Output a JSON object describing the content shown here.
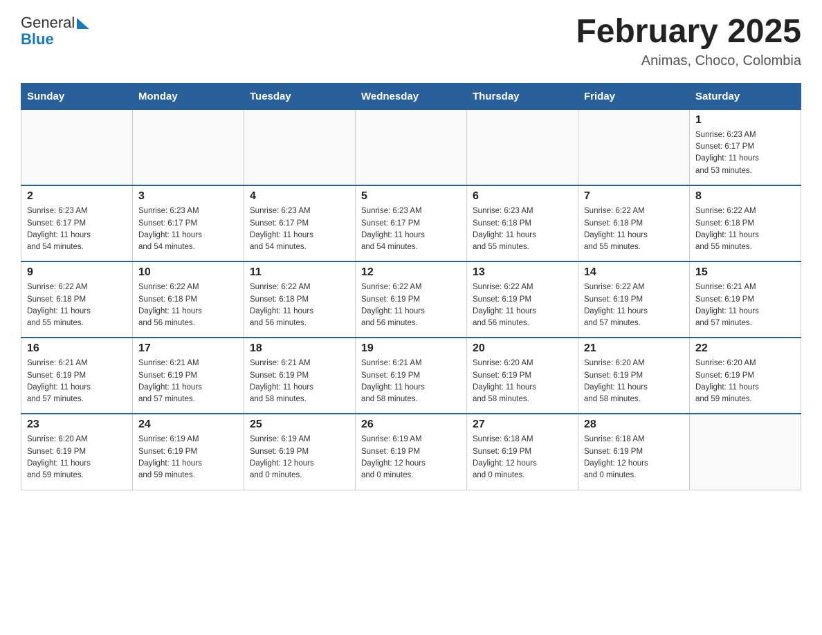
{
  "header": {
    "logo_general": "General",
    "logo_blue": "Blue",
    "title": "February 2025",
    "subtitle": "Animas, Choco, Colombia"
  },
  "calendar": {
    "days_of_week": [
      "Sunday",
      "Monday",
      "Tuesday",
      "Wednesday",
      "Thursday",
      "Friday",
      "Saturday"
    ],
    "weeks": [
      {
        "days": [
          {
            "num": "",
            "info": ""
          },
          {
            "num": "",
            "info": ""
          },
          {
            "num": "",
            "info": ""
          },
          {
            "num": "",
            "info": ""
          },
          {
            "num": "",
            "info": ""
          },
          {
            "num": "",
            "info": ""
          },
          {
            "num": "1",
            "info": "Sunrise: 6:23 AM\nSunset: 6:17 PM\nDaylight: 11 hours\nand 53 minutes."
          }
        ]
      },
      {
        "days": [
          {
            "num": "2",
            "info": "Sunrise: 6:23 AM\nSunset: 6:17 PM\nDaylight: 11 hours\nand 54 minutes."
          },
          {
            "num": "3",
            "info": "Sunrise: 6:23 AM\nSunset: 6:17 PM\nDaylight: 11 hours\nand 54 minutes."
          },
          {
            "num": "4",
            "info": "Sunrise: 6:23 AM\nSunset: 6:17 PM\nDaylight: 11 hours\nand 54 minutes."
          },
          {
            "num": "5",
            "info": "Sunrise: 6:23 AM\nSunset: 6:17 PM\nDaylight: 11 hours\nand 54 minutes."
          },
          {
            "num": "6",
            "info": "Sunrise: 6:23 AM\nSunset: 6:18 PM\nDaylight: 11 hours\nand 55 minutes."
          },
          {
            "num": "7",
            "info": "Sunrise: 6:22 AM\nSunset: 6:18 PM\nDaylight: 11 hours\nand 55 minutes."
          },
          {
            "num": "8",
            "info": "Sunrise: 6:22 AM\nSunset: 6:18 PM\nDaylight: 11 hours\nand 55 minutes."
          }
        ]
      },
      {
        "days": [
          {
            "num": "9",
            "info": "Sunrise: 6:22 AM\nSunset: 6:18 PM\nDaylight: 11 hours\nand 55 minutes."
          },
          {
            "num": "10",
            "info": "Sunrise: 6:22 AM\nSunset: 6:18 PM\nDaylight: 11 hours\nand 56 minutes."
          },
          {
            "num": "11",
            "info": "Sunrise: 6:22 AM\nSunset: 6:18 PM\nDaylight: 11 hours\nand 56 minutes."
          },
          {
            "num": "12",
            "info": "Sunrise: 6:22 AM\nSunset: 6:19 PM\nDaylight: 11 hours\nand 56 minutes."
          },
          {
            "num": "13",
            "info": "Sunrise: 6:22 AM\nSunset: 6:19 PM\nDaylight: 11 hours\nand 56 minutes."
          },
          {
            "num": "14",
            "info": "Sunrise: 6:22 AM\nSunset: 6:19 PM\nDaylight: 11 hours\nand 57 minutes."
          },
          {
            "num": "15",
            "info": "Sunrise: 6:21 AM\nSunset: 6:19 PM\nDaylight: 11 hours\nand 57 minutes."
          }
        ]
      },
      {
        "days": [
          {
            "num": "16",
            "info": "Sunrise: 6:21 AM\nSunset: 6:19 PM\nDaylight: 11 hours\nand 57 minutes."
          },
          {
            "num": "17",
            "info": "Sunrise: 6:21 AM\nSunset: 6:19 PM\nDaylight: 11 hours\nand 57 minutes."
          },
          {
            "num": "18",
            "info": "Sunrise: 6:21 AM\nSunset: 6:19 PM\nDaylight: 11 hours\nand 58 minutes."
          },
          {
            "num": "19",
            "info": "Sunrise: 6:21 AM\nSunset: 6:19 PM\nDaylight: 11 hours\nand 58 minutes."
          },
          {
            "num": "20",
            "info": "Sunrise: 6:20 AM\nSunset: 6:19 PM\nDaylight: 11 hours\nand 58 minutes."
          },
          {
            "num": "21",
            "info": "Sunrise: 6:20 AM\nSunset: 6:19 PM\nDaylight: 11 hours\nand 58 minutes."
          },
          {
            "num": "22",
            "info": "Sunrise: 6:20 AM\nSunset: 6:19 PM\nDaylight: 11 hours\nand 59 minutes."
          }
        ]
      },
      {
        "days": [
          {
            "num": "23",
            "info": "Sunrise: 6:20 AM\nSunset: 6:19 PM\nDaylight: 11 hours\nand 59 minutes."
          },
          {
            "num": "24",
            "info": "Sunrise: 6:19 AM\nSunset: 6:19 PM\nDaylight: 11 hours\nand 59 minutes."
          },
          {
            "num": "25",
            "info": "Sunrise: 6:19 AM\nSunset: 6:19 PM\nDaylight: 12 hours\nand 0 minutes."
          },
          {
            "num": "26",
            "info": "Sunrise: 6:19 AM\nSunset: 6:19 PM\nDaylight: 12 hours\nand 0 minutes."
          },
          {
            "num": "27",
            "info": "Sunrise: 6:18 AM\nSunset: 6:19 PM\nDaylight: 12 hours\nand 0 minutes."
          },
          {
            "num": "28",
            "info": "Sunrise: 6:18 AM\nSunset: 6:19 PM\nDaylight: 12 hours\nand 0 minutes."
          },
          {
            "num": "",
            "info": ""
          }
        ]
      }
    ]
  }
}
